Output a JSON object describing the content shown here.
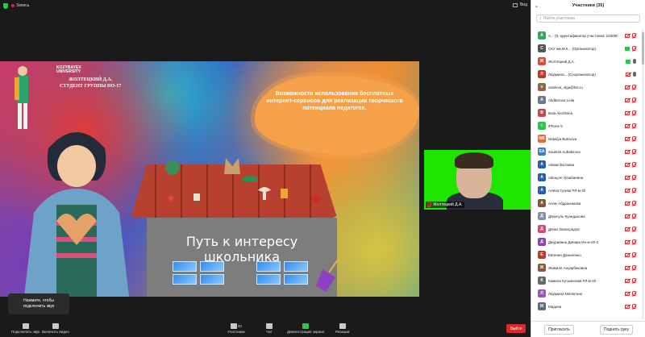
{
  "topbar": {
    "recording_label": "Запись",
    "view_label": "Вид"
  },
  "slide": {
    "logo_line1": "KOZYBAYEV",
    "logo_line2": "UNIVERSITY",
    "author_line1": "ЖОЛТЕЦКИЙ Д.А.",
    "author_line2": "СТУДЕНТ ГРУППЫ ИО-17",
    "title": "Возможности использования бесплатных интернет-сервисов для реализации творческого потенциала педагогов.",
    "house_sign": "Путь к интересу школьника"
  },
  "camera": {
    "name": "Жолтецкий Д.А."
  },
  "toast": {
    "line1": "Нажмите, чтобы",
    "line2": "подключить звук"
  },
  "toolbar": {
    "audio": "Подключить звук",
    "video": "Включить видео",
    "participants": "Участники",
    "participants_count": "33",
    "chat": "Чат",
    "share": "Демонстрация экрана",
    "reactions": "Реакции",
    "leave": "Выйти"
  },
  "panel": {
    "title": "Участники (35)",
    "search_placeholder": "Найти участника",
    "participants": [
      {
        "initial": "A",
        "name": "А... (9, идентификатор участника: 233050)",
        "color": "#3aa55d",
        "cam": "off",
        "mic": "off"
      },
      {
        "initial": "С",
        "name": "СКУ им.М.К... (Организатор)",
        "color": "#555",
        "cam": "on",
        "mic": "off"
      },
      {
        "initial": "Ж",
        "name": "Жолтецкий Д.А.",
        "color": "#d94f3d",
        "cam": "on",
        "mic": "on"
      },
      {
        "initial": "Л",
        "name": "Людмила... (Соорганизатор)",
        "color": "#c0392b",
        "cam": "off",
        "mic": "on"
      },
      {
        "initial": "v",
        "name": "vasileva_olga@kst.ru",
        "color": "#8b6b4a",
        "cam": "off",
        "mic": "off"
      },
      {
        "initial": "A",
        "name": "Akdberova Leila",
        "color": "#6b7a8f",
        "cam": "off",
        "mic": "off"
      },
      {
        "initial": "B",
        "name": "Bota Alezhbina",
        "color": "#c24a4a",
        "cam": "off",
        "mic": "off"
      },
      {
        "initial": "i",
        "name": "iPhone 5",
        "color": "#2ec54d",
        "cam": "off",
        "mic": "off"
      },
      {
        "initial": "NB",
        "name": "Nataliya Bubnova",
        "color": "#e56b2e",
        "cam": "off",
        "mic": "off"
      },
      {
        "initial": "SA",
        "name": "Saulesh Aubakirova",
        "color": "#3b82c4",
        "cam": "off",
        "mic": "off"
      },
      {
        "initial": "А",
        "name": "Айман Ботаева",
        "color": "#2b5fa8",
        "cam": "off",
        "mic": "off"
      },
      {
        "initial": "А",
        "name": "Айсауле Урзабаевна",
        "color": "#2b5fa8",
        "cam": "off",
        "mic": "off"
      },
      {
        "initial": "А",
        "name": "Алёна Гусева РЛ-м-20",
        "color": "#2b5fa8",
        "cam": "off",
        "mic": "off"
      },
      {
        "initial": "А",
        "name": "Асем Абдрахимова",
        "color": "#7a5c3a",
        "cam": "off",
        "mic": "off"
      },
      {
        "initial": "Д",
        "name": "Динагуль Куандыкова",
        "color": "#8a8fa8",
        "cam": "off",
        "mic": "off"
      },
      {
        "initial": "Д",
        "name": "Денис Виноградов",
        "color": "#d44a7a",
        "cam": "off",
        "mic": "off"
      },
      {
        "initial": "Д",
        "name": "Джуравина Динара Ин-м-20-2",
        "color": "#8e44ad",
        "cam": "off",
        "mic": "off"
      },
      {
        "initial": "Е",
        "name": "Евгения Даниленко",
        "color": "#c0392b",
        "cam": "off",
        "mic": "off"
      },
      {
        "initial": "Ж",
        "name": "Жамиля Ануарбековна",
        "color": "#8b5a3c",
        "cam": "off",
        "mic": "off"
      },
      {
        "initial": "К",
        "name": "Камила Кутаиннова РЛ-м-20",
        "color": "#6a6a6a",
        "cam": "off",
        "mic": "off"
      },
      {
        "initial": "Л",
        "name": "Людмила Мелютина",
        "color": "#9b59b6",
        "cam": "off",
        "mic": "off"
      },
      {
        "initial": "М",
        "name": "Мадина",
        "color": "#5d6d7e",
        "cam": "off",
        "mic": "off"
      }
    ],
    "invite": "Пригласить",
    "raise_hand": "Поднять руку"
  },
  "colors": {
    "zoom_green": "#2ec54d",
    "leave_red": "#e02828",
    "camera_bg": "#1ee600"
  }
}
